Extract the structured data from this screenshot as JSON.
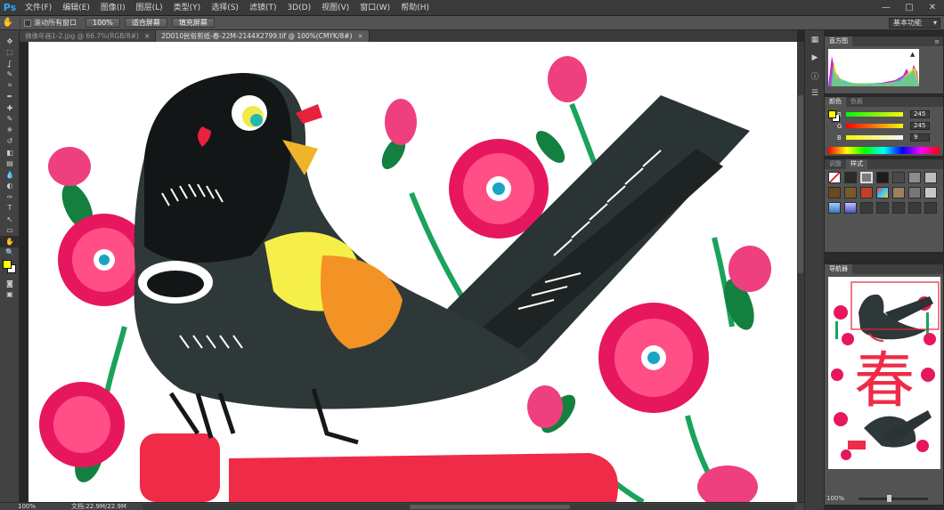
{
  "app": {
    "logo": "Ps",
    "menu": [
      "文件(F)",
      "编辑(E)",
      "图像(I)",
      "图层(L)",
      "类型(Y)",
      "选择(S)",
      "滤镜(T)",
      "3D(D)",
      "视图(V)",
      "窗口(W)",
      "帮助(H)"
    ],
    "window_controls": [
      "—",
      "□",
      "✕"
    ]
  },
  "options": {
    "scroll_all_label": "滚动所有窗口",
    "zoom_100": "100%",
    "fit_screen": "适合屏幕",
    "fill_screen": "填充屏幕",
    "workspace": "基本功能"
  },
  "tabs": [
    {
      "label": "佛佛年画1-2.jpg @ 66.7%(RGB/8#)",
      "close": "×",
      "active": false
    },
    {
      "label": "2D010民俗剪纸-春-22M-2144X2799.tif @ 100%(CMYK/8#)",
      "close": "×",
      "active": true
    }
  ],
  "tools": [
    "move-tool",
    "marquee-tool",
    "lasso-tool",
    "quick-select-tool",
    "crop-tool",
    "eyedropper-tool",
    "healing-tool",
    "brush-tool",
    "clone-stamp-tool",
    "history-brush-tool",
    "eraser-tool",
    "gradient-tool",
    "blur-tool",
    "dodge-tool",
    "pen-tool",
    "type-tool",
    "path-select-tool",
    "shape-tool",
    "hand-tool",
    "zoom-tool"
  ],
  "tool_glyphs": [
    "✥",
    "⬚",
    "ʆ",
    "✎",
    "⌗",
    "✒",
    "✚",
    "✎",
    "⎈",
    "↺",
    "◧",
    "▤",
    "💧",
    "◐",
    "✑",
    "T",
    "↖",
    "▭",
    "✋",
    "🔍"
  ],
  "status": {
    "zoom": "100%",
    "doc": "文档:22.9M/22.9M"
  },
  "panels": {
    "histogram": {
      "tab": "直方图",
      "menu": "≡"
    },
    "color": {
      "tabs": [
        "颜色",
        "色板"
      ],
      "channels": [
        {
          "label": "R",
          "value": "245"
        },
        {
          "label": "G",
          "value": "245"
        },
        {
          "label": "B",
          "value": "9"
        }
      ]
    },
    "styles": {
      "tabs": [
        "调整",
        "样式"
      ]
    },
    "navigator": {
      "tab": "导航器",
      "zoom": "100%"
    }
  },
  "colors": {
    "fg": "#ffff00",
    "bg": "#ffffff",
    "accent": "#31a8ff"
  }
}
